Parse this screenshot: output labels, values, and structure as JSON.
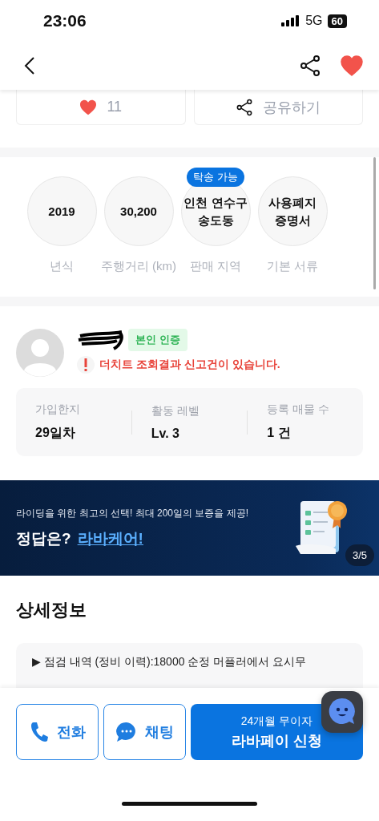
{
  "status_bar": {
    "time": "23:06",
    "network": "5G",
    "battery": "60"
  },
  "nav": {
    "liked": true
  },
  "actions": {
    "like_count": "11",
    "share_label": "공유하기"
  },
  "specs": [
    {
      "value": "2019",
      "label": "년식"
    },
    {
      "value": "30,200",
      "label": "주행거리 (km)"
    },
    {
      "value": "인천 연수구 송도동",
      "label": "판매 지역",
      "badge": "탁송 가능"
    },
    {
      "value": "사용폐지 증명서",
      "label": "기본 서류"
    }
  ],
  "seller": {
    "verified_badge": "본인 인증",
    "warning": "더치트 조회결과 신고건이 있습니다.",
    "stats": [
      {
        "label": "가입한지",
        "value": "29일차"
      },
      {
        "label": "활동 레벨",
        "value": "Lv. 3"
      },
      {
        "label": "등록 매물 수",
        "value": "1 건"
      }
    ]
  },
  "banner": {
    "subtitle": "라이딩을 위한 최고의 선택! 최대 200일의 보증을 제공!",
    "title": "정답은?",
    "link": "라바케어!",
    "pager": "3/5"
  },
  "details": {
    "title": "상세정보",
    "text": "▶ 점검 내역 (정비 이력):18000 순정 머플러에서 요시무"
  },
  "bottom": {
    "call": "전화",
    "chat": "채팅",
    "pay_sub": "24개월 무이자",
    "pay": "라바페이 신청"
  }
}
